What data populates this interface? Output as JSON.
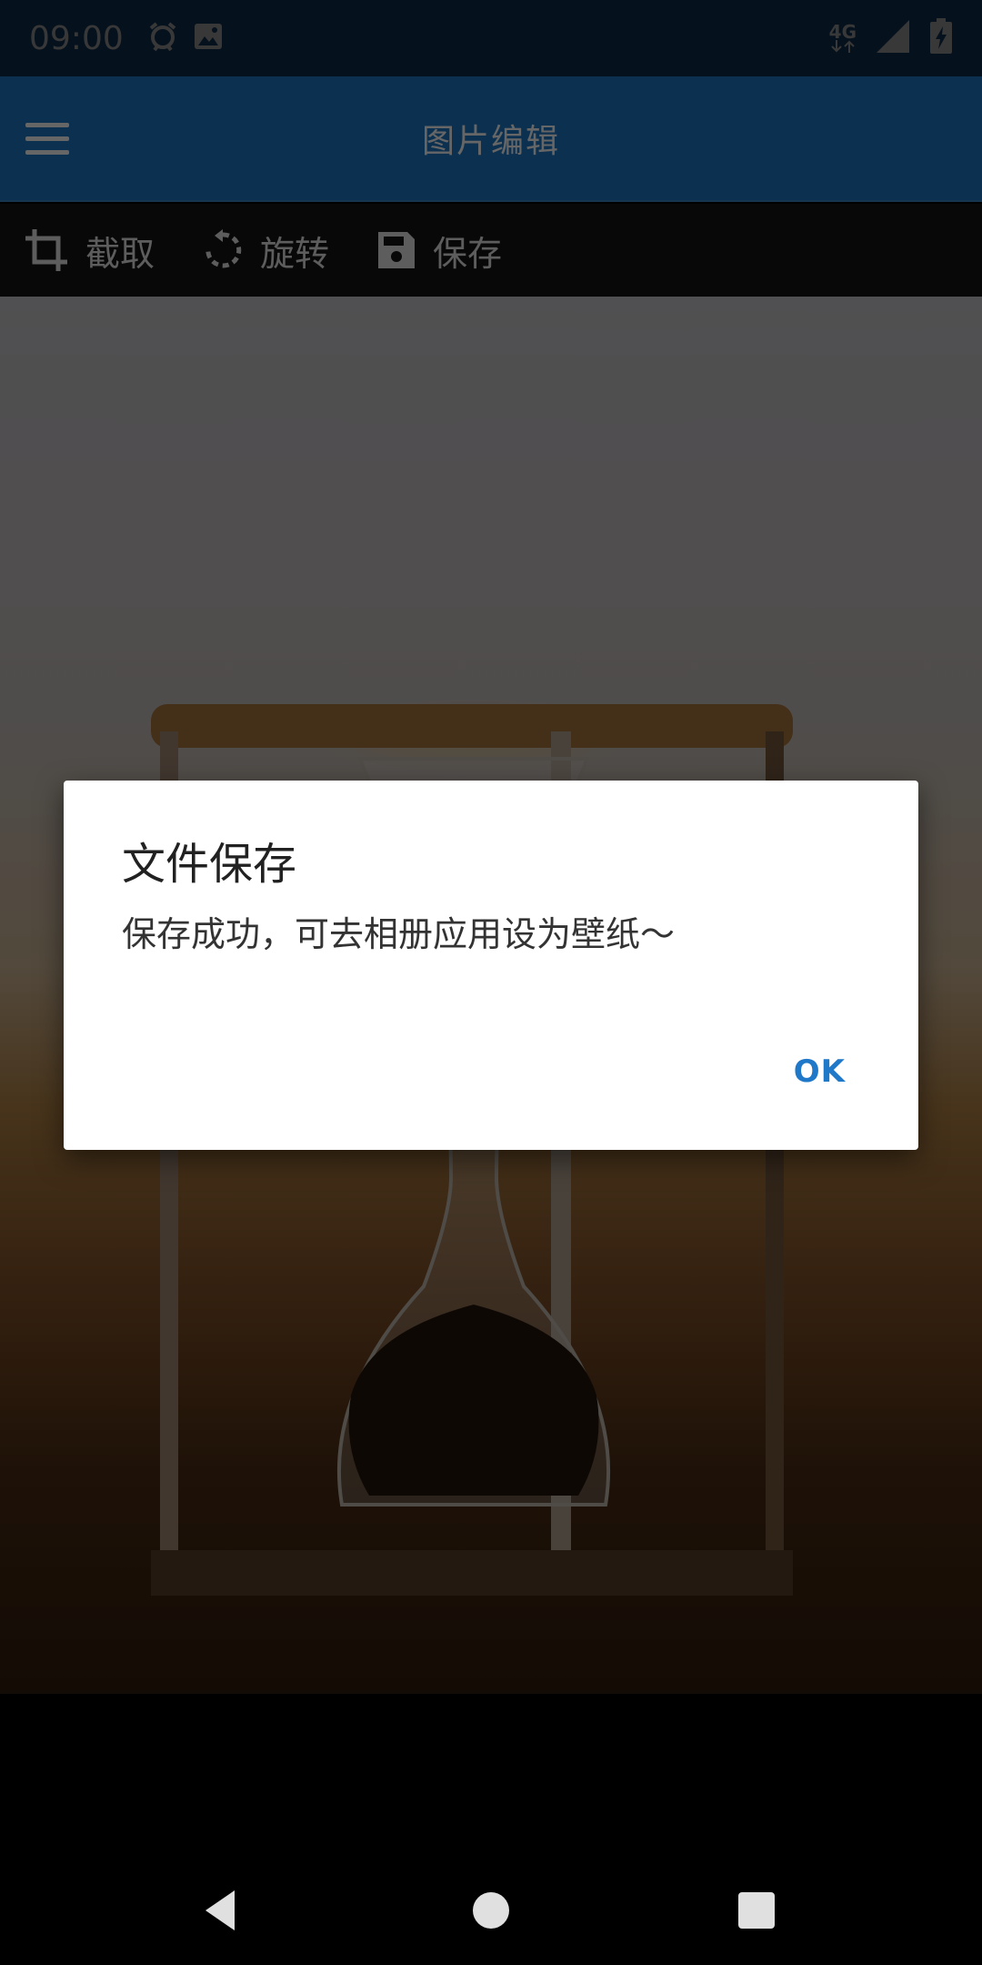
{
  "status_bar": {
    "time": "09:00",
    "network": "4G",
    "icons": [
      "alarm-icon",
      "image-notification-icon",
      "network-4g-icon",
      "signal-icon",
      "battery-charging-icon"
    ]
  },
  "app_bar": {
    "title": "图片编辑",
    "menu_icon": "hamburger-menu-icon"
  },
  "toolbar": {
    "crop_label": "截取",
    "rotate_label": "旋转",
    "save_label": "保存"
  },
  "dialog": {
    "title": "文件保存",
    "message": "保存成功，可去相册应用设为壁纸～",
    "ok_label": "OK"
  },
  "nav_bar": {
    "icons": [
      "back-icon",
      "home-icon",
      "recents-icon"
    ]
  },
  "colors": {
    "primary": "#1f78c8",
    "primary_dark": "#1a4f85",
    "toolbar_bg": "#151515",
    "dialog_bg": "#ffffff"
  }
}
